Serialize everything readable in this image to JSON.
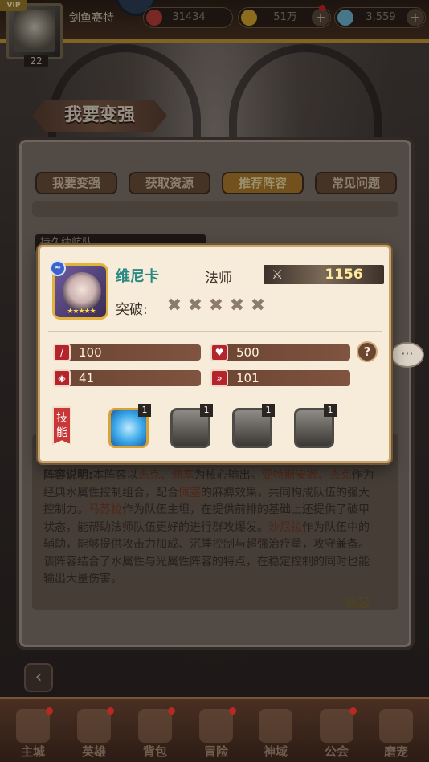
{
  "topbar": {
    "vip": "VIP",
    "level": "22",
    "player_name": "剑鱼赛特",
    "resources": [
      {
        "name": "stamina",
        "value": "31434",
        "color": "#b9403a"
      },
      {
        "name": "gold",
        "value": "51万",
        "color": "#d8a82e"
      },
      {
        "name": "diamond",
        "value": "3,559",
        "color": "#6fb7d6"
      }
    ]
  },
  "page_title": "我要变强",
  "tabs": [
    {
      "label": "我要变强",
      "active": false
    },
    {
      "label": "获取资源",
      "active": false
    },
    {
      "label": "推荐阵容",
      "active": true
    },
    {
      "label": "常见问题",
      "active": false
    }
  ],
  "section_header": "持久续航队",
  "description": {
    "label": "阵容说明:",
    "text_1": "本阵容以",
    "hl_1": "杰克、佩塞",
    "text_2": "为核心输出。",
    "hl_2": "亚特斯安娜、杰克",
    "text_3": "作为经典水属性控制组合，配合",
    "hl_3": "佩塞",
    "text_4": "的麻痹效果，共同构成队伍的强大控制力。",
    "hl_4": "马苏拉",
    "text_5": "作为队伍主坦，在提供前排的基础上还提供了破甲状态，能帮助法师队伍更好的进行群攻爆发。",
    "hl_5": "沙尼拉",
    "text_6": "作为队伍中的辅助，能够提供攻击力加成、沉睡控制与超强治疗量，攻守兼备。该阵容结合了水属性与光属性阵容的特点，在稳定控制的同时也能输出大量伤害。"
  },
  "collapse": "收起",
  "bottom_nav": [
    {
      "label": "主城",
      "badge": true
    },
    {
      "label": "英雄",
      "badge": true
    },
    {
      "label": "背包",
      "badge": true
    },
    {
      "label": "冒险",
      "badge": true
    },
    {
      "label": "神域",
      "badge": false
    },
    {
      "label": "公会",
      "badge": true
    },
    {
      "label": "磨宠",
      "badge": false
    }
  ],
  "hero_popup": {
    "name": "维尼卡",
    "class": "法师",
    "power": "1156",
    "break_label": "突破:",
    "element": "water",
    "star_count": 5,
    "stats": {
      "attack": "100",
      "hp": "500",
      "defense": "41",
      "speed": "101"
    },
    "help": "?",
    "skill_label": "技能",
    "skills": [
      {
        "level": "1",
        "unlocked": true
      },
      {
        "level": "1",
        "unlocked": false
      },
      {
        "level": "1",
        "unlocked": false
      },
      {
        "level": "1",
        "unlocked": false
      }
    ]
  },
  "speech_bubble": "···"
}
